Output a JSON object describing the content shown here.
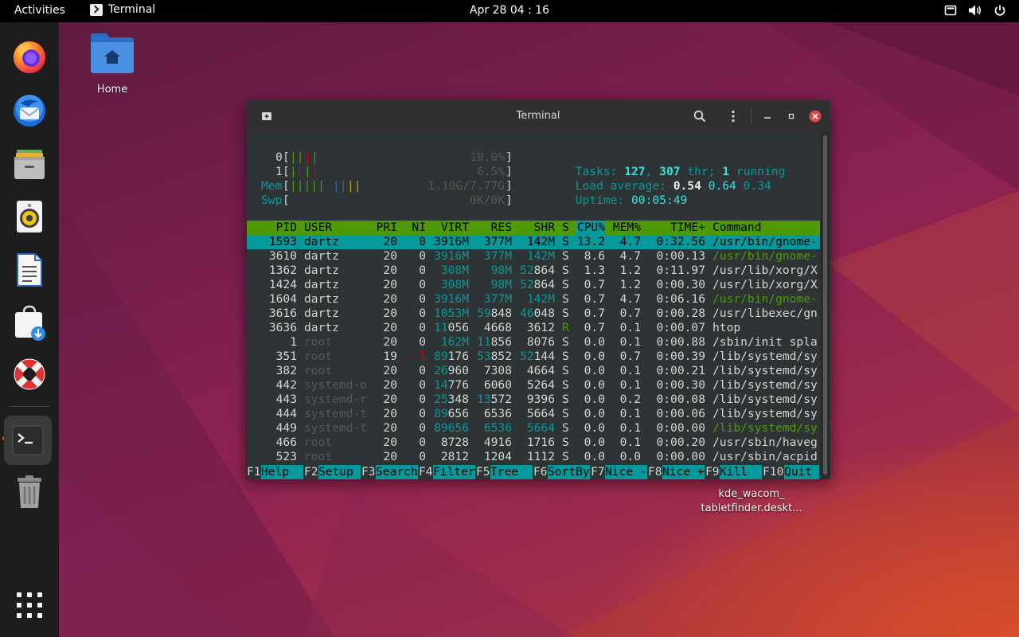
{
  "topbar": {
    "activities": "Activities",
    "app_name": "Terminal",
    "clock": "Apr 28  04 : 16"
  },
  "dock": {
    "items": [
      "firefox-icon",
      "thunderbird-icon",
      "files-icon",
      "rhythmbox-icon",
      "writer-icon",
      "software-icon",
      "help-icon",
      "terminal-icon",
      "trash-icon",
      "app-grid-icon"
    ]
  },
  "desktop": {
    "home_label": "Home",
    "file_label_1": "kde_wacom_",
    "file_label_2": "tabletfinder.deskt..."
  },
  "terminal": {
    "title": "Terminal",
    "meters": {
      "cpu0_label": "0",
      "cpu0_value": "10.0%",
      "cpu1_label": "1",
      "cpu1_value": "6.5%",
      "mem_label": "Mem",
      "mem_value": "1.10G/7.77G",
      "swp_label": "Swp",
      "swp_value": "0K/0K"
    },
    "stats": {
      "tasks_label": "Tasks: ",
      "tasks": "127",
      "threads": "307",
      "thr_label": " thr; ",
      "running": "1",
      "running_label": " running",
      "load_label": "Load average: ",
      "load1": "0.54",
      "load5": "0.64",
      "load15": "0.34",
      "uptime_label": "Uptime: ",
      "uptime": "00:05:49"
    },
    "columns": [
      "PID",
      "USER",
      "PRI",
      "NI",
      "VIRT",
      "RES",
      "SHR",
      "S",
      "CPU%",
      "MEM%",
      "TIME+",
      "Command"
    ],
    "processes": [
      {
        "pid": "1593",
        "user": "dartz",
        "pri": "20",
        "ni": "0",
        "virt": "3916M",
        "res": "377M",
        "shr": "142M",
        "s": "S",
        "cpu": "13.2",
        "mem": "4.7",
        "time": "0:32.56",
        "cmd": "/usr/bin/gnome-"
      },
      {
        "pid": "3610",
        "user": "dartz",
        "pri": "20",
        "ni": "0",
        "virt": "3916M",
        "res": "377M",
        "shr": "142M",
        "s": "S",
        "cpu": "8.6",
        "mem": "4.7",
        "time": "0:00.13",
        "cmd": "/usr/bin/gnome-"
      },
      {
        "pid": "1362",
        "user": "dartz",
        "pri": "20",
        "ni": "0",
        "virt": "308M",
        "res": "98M",
        "shr": "52864",
        "s": "S",
        "cpu": "1.3",
        "mem": "1.2",
        "time": "0:11.97",
        "cmd": "/usr/lib/xorg/X"
      },
      {
        "pid": "1424",
        "user": "dartz",
        "pri": "20",
        "ni": "0",
        "virt": "308M",
        "res": "98M",
        "shr": "52864",
        "s": "S",
        "cpu": "0.7",
        "mem": "1.2",
        "time": "0:00.30",
        "cmd": "/usr/lib/xorg/X"
      },
      {
        "pid": "1604",
        "user": "dartz",
        "pri": "20",
        "ni": "0",
        "virt": "3916M",
        "res": "377M",
        "shr": "142M",
        "s": "S",
        "cpu": "0.7",
        "mem": "4.7",
        "time": "0:06.16",
        "cmd": "/usr/bin/gnome-"
      },
      {
        "pid": "3616",
        "user": "dartz",
        "pri": "20",
        "ni": "0",
        "virt": "1053M",
        "res": "59848",
        "shr": "46048",
        "s": "S",
        "cpu": "0.7",
        "mem": "0.7",
        "time": "0:00.28",
        "cmd": "/usr/libexec/gn"
      },
      {
        "pid": "3636",
        "user": "dartz",
        "pri": "20",
        "ni": "0",
        "virt": "11056",
        "res": "4668",
        "shr": "3612",
        "s": "R",
        "cpu": "0.7",
        "mem": "0.1",
        "time": "0:00.07",
        "cmd": "htop"
      },
      {
        "pid": "1",
        "user": "root",
        "pri": "20",
        "ni": "0",
        "virt": "162M",
        "res": "11856",
        "shr": "8076",
        "s": "S",
        "cpu": "0.0",
        "mem": "0.1",
        "time": "0:00.88",
        "cmd": "/sbin/init spla"
      },
      {
        "pid": "351",
        "user": "root",
        "pri": "19",
        "ni": "-1",
        "virt": "89176",
        "res": "53852",
        "shr": "52144",
        "s": "S",
        "cpu": "0.0",
        "mem": "0.7",
        "time": "0:00.39",
        "cmd": "/lib/systemd/sy"
      },
      {
        "pid": "382",
        "user": "root",
        "pri": "20",
        "ni": "0",
        "virt": "26960",
        "res": "7308",
        "shr": "4664",
        "s": "S",
        "cpu": "0.0",
        "mem": "0.1",
        "time": "0:00.21",
        "cmd": "/lib/systemd/sy"
      },
      {
        "pid": "442",
        "user": "systemd-o",
        "pri": "20",
        "ni": "0",
        "virt": "14776",
        "res": "6060",
        "shr": "5264",
        "s": "S",
        "cpu": "0.0",
        "mem": "0.1",
        "time": "0:00.30",
        "cmd": "/lib/systemd/sy"
      },
      {
        "pid": "443",
        "user": "systemd-r",
        "pri": "20",
        "ni": "0",
        "virt": "25348",
        "res": "13572",
        "shr": "9396",
        "s": "S",
        "cpu": "0.0",
        "mem": "0.2",
        "time": "0:00.08",
        "cmd": "/lib/systemd/sy"
      },
      {
        "pid": "444",
        "user": "systemd-t",
        "pri": "20",
        "ni": "0",
        "virt": "89656",
        "res": "6536",
        "shr": "5664",
        "s": "S",
        "cpu": "0.0",
        "mem": "0.1",
        "time": "0:00.06",
        "cmd": "/lib/systemd/sy"
      },
      {
        "pid": "449",
        "user": "systemd-t",
        "pri": "20",
        "ni": "0",
        "virt": "89656",
        "res": "6536",
        "shr": "5664",
        "s": "S",
        "cpu": "0.0",
        "mem": "0.1",
        "time": "0:00.00",
        "cmd": "/lib/systemd/sy"
      },
      {
        "pid": "466",
        "user": "root",
        "pri": "20",
        "ni": "0",
        "virt": "8728",
        "res": "4916",
        "shr": "1716",
        "s": "S",
        "cpu": "0.0",
        "mem": "0.1",
        "time": "0:00.20",
        "cmd": "/usr/sbin/haveg"
      },
      {
        "pid": "523",
        "user": "root",
        "pri": "20",
        "ni": "0",
        "virt": "2812",
        "res": "1204",
        "shr": "1112",
        "s": "S",
        "cpu": "0.0",
        "mem": "0.0",
        "time": "0:00.00",
        "cmd": "/usr/sbin/acpid"
      }
    ],
    "function_keys": [
      {
        "key": "F1",
        "label": "Help  "
      },
      {
        "key": "F2",
        "label": "Setup "
      },
      {
        "key": "F3",
        "label": "Search"
      },
      {
        "key": "F4",
        "label": "Filter"
      },
      {
        "key": "F5",
        "label": "Tree  "
      },
      {
        "key": "F6",
        "label": "SortBy"
      },
      {
        "key": "F7",
        "label": "Nice -"
      },
      {
        "key": "F8",
        "label": "Nice +"
      },
      {
        "key": "F9",
        "label": "Kill  "
      },
      {
        "key": "F10",
        "label": "Quit "
      }
    ]
  }
}
